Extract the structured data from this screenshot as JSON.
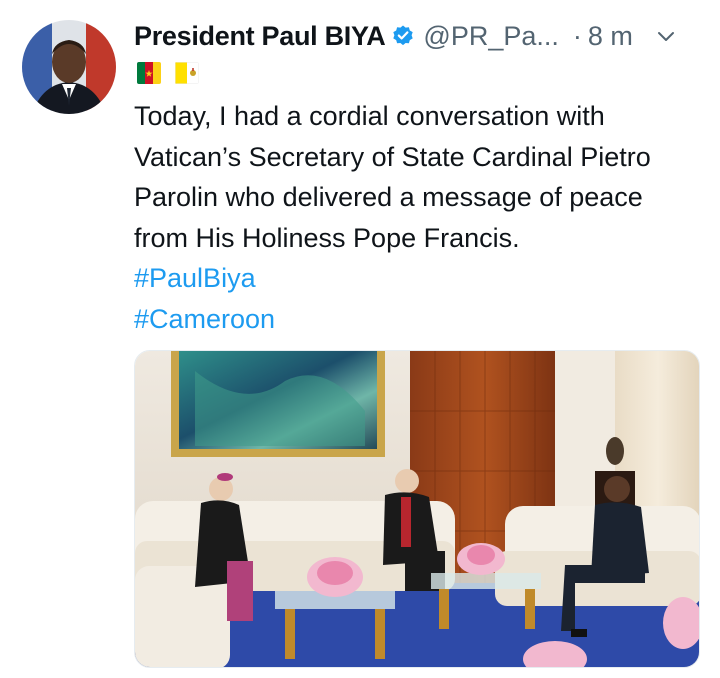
{
  "author": {
    "display_name": "President Paul BIYA",
    "handle": "@PR_Pa...",
    "separator": "·",
    "time": "8 m",
    "verified": true,
    "avatar_icon": "avatar-photo"
  },
  "flags": [
    {
      "name": "cameroon-flag-icon",
      "colors": [
        "#007a3d",
        "#ce1126",
        "#fcd116"
      ]
    },
    {
      "name": "vatican-flag-icon",
      "colors": [
        "#ffe000",
        "#ffffff"
      ]
    }
  ],
  "tweet": {
    "text": "Today, I had a cordial conversation with Vatican’s Secretary of State Cardinal Pietro Parolin who delivered a message of peace from His Holiness Pope Francis.",
    "hashtags": [
      "#PaulBiya",
      "#Cameroon"
    ]
  },
  "colors": {
    "link": "#1d9bf0",
    "text": "#0f1419",
    "muted": "#536471"
  }
}
